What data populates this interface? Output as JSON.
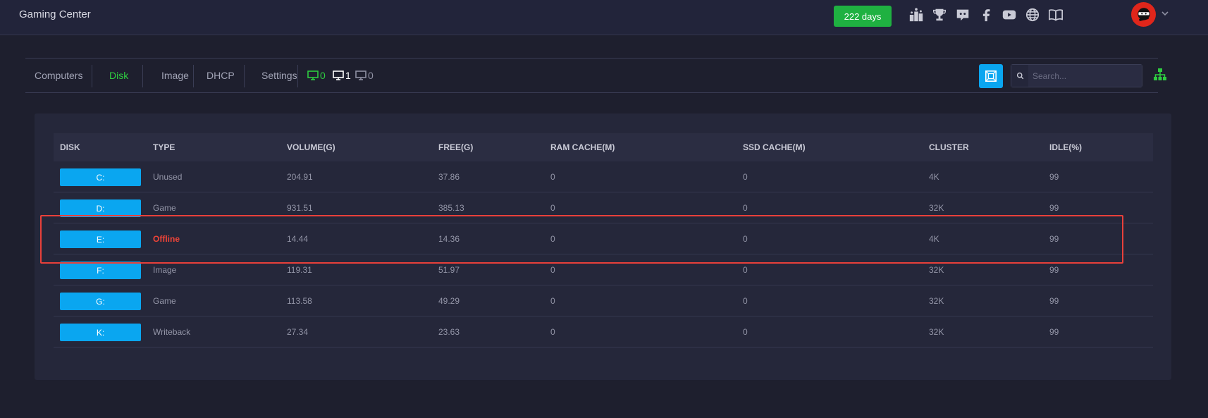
{
  "app": {
    "title": "Gaming Center",
    "days_badge": "222 days"
  },
  "top_icons": [
    "podium-icon",
    "trophy-icon",
    "discord-icon",
    "facebook-icon",
    "youtube-icon",
    "globe-icon",
    "book-icon"
  ],
  "nav": {
    "tabs": [
      {
        "label": "Computers",
        "active": false
      },
      {
        "label": "Disk",
        "active": true
      },
      {
        "label": "Image",
        "active": false
      },
      {
        "label": "DHCP",
        "active": false
      },
      {
        "label": "Settings",
        "active": false
      }
    ],
    "stats": [
      {
        "icon": "monitor-online-icon",
        "value": "0",
        "color": "#2ecc40"
      },
      {
        "icon": "monitor-active-icon",
        "value": "1",
        "color": "#ffffff"
      },
      {
        "icon": "monitor-offline-icon",
        "value": "0",
        "color": "#8f91a3"
      }
    ],
    "search_placeholder": "Search..."
  },
  "table": {
    "headers": [
      "DISK",
      "TYPE",
      "VOLUME(G)",
      "FREE(G)",
      "RAM CACHE(M)",
      "SSD CACHE(M)",
      "CLUSTER",
      "IDLE(%)"
    ],
    "rows": [
      {
        "disk": "C:",
        "type": "Unused",
        "volume": "204.91",
        "free": "37.86",
        "ram": "0",
        "ssd": "0",
        "cluster": "4K",
        "idle": "99"
      },
      {
        "disk": "D:",
        "type": "Game",
        "volume": "931.51",
        "free": "385.13",
        "ram": "0",
        "ssd": "0",
        "cluster": "32K",
        "idle": "99"
      },
      {
        "disk": "E:",
        "type": "Offline",
        "volume": "14.44",
        "free": "14.36",
        "ram": "0",
        "ssd": "0",
        "cluster": "4K",
        "idle": "99"
      },
      {
        "disk": "F:",
        "type": "Image",
        "volume": "119.31",
        "free": "51.97",
        "ram": "0",
        "ssd": "0",
        "cluster": "32K",
        "idle": "99"
      },
      {
        "disk": "G:",
        "type": "Game",
        "volume": "113.58",
        "free": "49.29",
        "ram": "0",
        "ssd": "0",
        "cluster": "32K",
        "idle": "99"
      },
      {
        "disk": "K:",
        "type": "Writeback",
        "volume": "27.34",
        "free": "23.63",
        "ram": "0",
        "ssd": "0",
        "cluster": "32K",
        "idle": "99"
      }
    ]
  },
  "colors": {
    "accent": "#0aa6f0",
    "success": "#1fb141",
    "danger": "#f04438",
    "highlight": "#e8403a"
  }
}
